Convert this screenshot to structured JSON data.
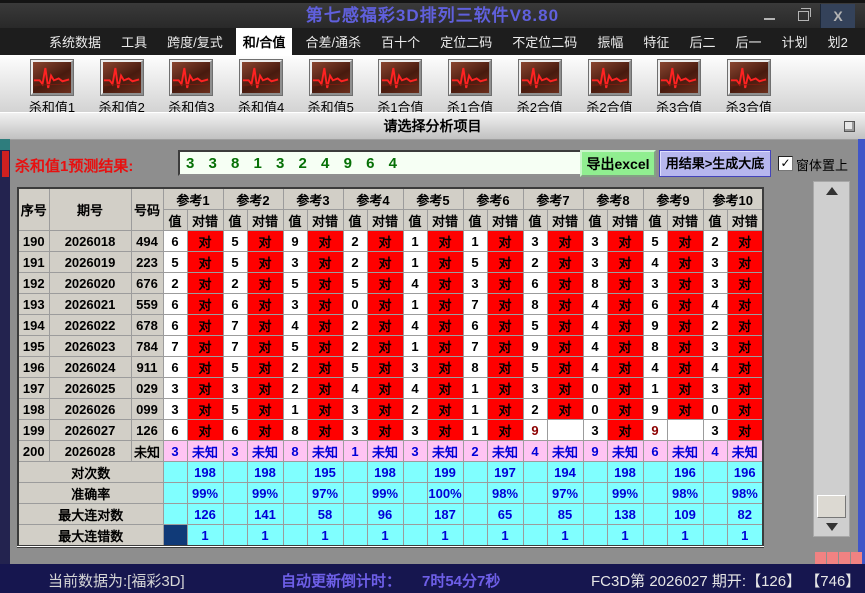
{
  "colors": {
    "title_text": "#6060dd",
    "hit_red": "#ff0000",
    "miss_dark_red": "#8b0000",
    "unknown_pink": "#ffc4f4",
    "summary_cyan": "#80ffff",
    "blue_value_text": "#0000d8",
    "selected_cell_navy": "#103a78",
    "export_button_green": "#90ee90",
    "generate_button_lavender": "#b7b7ee",
    "statusbar_navy": "#16164f",
    "countdown_purple": "#6e5fe8",
    "prediction_text_green": "#067006",
    "grip_coral": "#f08282"
  },
  "window": {
    "title": "第七感福彩3D排列三软件V8.80",
    "minimize_glyph": "–",
    "close_glyph": "X"
  },
  "menu": {
    "items": [
      "系统数据",
      "工具",
      "跨度/复式",
      "和/合值",
      "合差/通杀",
      "百十个",
      "定位二码",
      "不定位二码",
      "振幅",
      "特征",
      "后二",
      "后一",
      "计划",
      "划2"
    ],
    "selected": "和/合值"
  },
  "toolbar": {
    "buttons": [
      "杀和值1",
      "杀和值2",
      "杀和值3",
      "杀和值4",
      "杀和值5",
      "杀1合值",
      "杀1合值",
      "杀2合值",
      "杀2合值",
      "杀3合值",
      "杀3合值"
    ],
    "caption": "请选择分析项目"
  },
  "prediction": {
    "label": "杀和值1预测结果:",
    "value": "3 3 8 1 3 2 4 9 6 4",
    "export_button": "导出excel",
    "generate_button": "用结果>生成大底",
    "always_on_top_label": "窗体置上",
    "always_on_top_checked": true
  },
  "table": {
    "corner_headers": [
      "序号",
      "期号",
      "号码"
    ],
    "ref_headers": [
      "参考1",
      "参考2",
      "参考3",
      "参考4",
      "参考5",
      "参考6",
      "参考7",
      "参考8",
      "参考9",
      "参考10"
    ],
    "sub_headers": [
      "值",
      "对错"
    ],
    "hit_label": "对",
    "unknown_label": "未知",
    "rows": [
      {
        "seq": "190",
        "period": "2026018",
        "num": "494",
        "values": [
          "6",
          "5",
          "9",
          "2",
          "1",
          "1",
          "3",
          "3",
          "5",
          "2"
        ],
        "results": [
          "对",
          "对",
          "对",
          "对",
          "对",
          "对",
          "对",
          "对",
          "对",
          "对"
        ]
      },
      {
        "seq": "191",
        "period": "2026019",
        "num": "223",
        "values": [
          "5",
          "5",
          "3",
          "2",
          "1",
          "5",
          "2",
          "3",
          "4",
          "3"
        ],
        "results": [
          "对",
          "对",
          "对",
          "对",
          "对",
          "对",
          "对",
          "对",
          "对",
          "对"
        ]
      },
      {
        "seq": "192",
        "period": "2026020",
        "num": "676",
        "values": [
          "2",
          "2",
          "5",
          "5",
          "4",
          "3",
          "6",
          "8",
          "3",
          "3"
        ],
        "results": [
          "对",
          "对",
          "对",
          "对",
          "对",
          "对",
          "对",
          "对",
          "对",
          "对"
        ]
      },
      {
        "seq": "193",
        "period": "2026021",
        "num": "559",
        "values": [
          "6",
          "6",
          "3",
          "0",
          "1",
          "7",
          "8",
          "4",
          "6",
          "4"
        ],
        "results": [
          "对",
          "对",
          "对",
          "对",
          "对",
          "对",
          "对",
          "对",
          "对",
          "对"
        ]
      },
      {
        "seq": "194",
        "period": "2026022",
        "num": "678",
        "values": [
          "6",
          "7",
          "4",
          "2",
          "4",
          "6",
          "5",
          "4",
          "9",
          "2"
        ],
        "results": [
          "对",
          "对",
          "对",
          "对",
          "对",
          "对",
          "对",
          "对",
          "对",
          "对"
        ]
      },
      {
        "seq": "195",
        "period": "2026023",
        "num": "784",
        "values": [
          "7",
          "7",
          "5",
          "2",
          "1",
          "7",
          "9",
          "4",
          "8",
          "3"
        ],
        "results": [
          "对",
          "对",
          "对",
          "对",
          "对",
          "对",
          "对",
          "对",
          "对",
          "对"
        ]
      },
      {
        "seq": "196",
        "period": "2026024",
        "num": "911",
        "values": [
          "6",
          "5",
          "2",
          "5",
          "3",
          "8",
          "5",
          "4",
          "4",
          "4"
        ],
        "results": [
          "对",
          "对",
          "对",
          "对",
          "对",
          "对",
          "对",
          "对",
          "对",
          "对"
        ]
      },
      {
        "seq": "197",
        "period": "2026025",
        "num": "029",
        "values": [
          "3",
          "3",
          "2",
          "4",
          "4",
          "1",
          "3",
          "0",
          "1",
          "3"
        ],
        "results": [
          "对",
          "对",
          "对",
          "对",
          "对",
          "对",
          "对",
          "对",
          "对",
          "对"
        ]
      },
      {
        "seq": "198",
        "period": "2026026",
        "num": "099",
        "values": [
          "3",
          "5",
          "1",
          "3",
          "2",
          "1",
          "2",
          "0",
          "9",
          "0"
        ],
        "results": [
          "对",
          "对",
          "对",
          "对",
          "对",
          "对",
          "对",
          "对",
          "对",
          "对"
        ]
      },
      {
        "seq": "199",
        "period": "2026027",
        "num": "126",
        "values": [
          "6",
          "6",
          "8",
          "3",
          "3",
          "1",
          "9",
          "3",
          "9",
          "3"
        ],
        "results": [
          "对",
          "对",
          "对",
          "对",
          "对",
          "对",
          "",
          "对",
          "",
          "对"
        ]
      },
      {
        "seq": "200",
        "period": "2026028",
        "num": "未知",
        "values": [
          "3",
          "3",
          "8",
          "1",
          "3",
          "2",
          "4",
          "9",
          "6",
          "4"
        ],
        "results": [
          "未知",
          "未知",
          "未知",
          "未知",
          "未知",
          "未知",
          "未知",
          "未知",
          "未知",
          "未知"
        ],
        "unknown": true
      }
    ],
    "summary_rows": [
      {
        "label": "对次数",
        "values": [
          "198",
          "198",
          "195",
          "198",
          "199",
          "197",
          "194",
          "198",
          "196",
          "196"
        ]
      },
      {
        "label": "准确率",
        "values": [
          "99%",
          "99%",
          "97%",
          "99%",
          "100%",
          "98%",
          "97%",
          "99%",
          "98%",
          "98%"
        ]
      },
      {
        "label": "最大连对数",
        "values": [
          "126",
          "141",
          "58",
          "96",
          "187",
          "65",
          "85",
          "138",
          "109",
          "82"
        ]
      },
      {
        "label": "最大连错数",
        "values": [
          "1",
          "1",
          "1",
          "1",
          "1",
          "1",
          "1",
          "1",
          "1",
          "1"
        ],
        "selected_first_cell": true
      }
    ]
  },
  "statusbar": {
    "current_data": "当前数据为:[福彩3D]",
    "countdown_label": "自动更新倒计时：",
    "countdown_value": "7时54分7秒",
    "draw_info": "FC3D第 2026027 期开:【126】 【746】"
  }
}
